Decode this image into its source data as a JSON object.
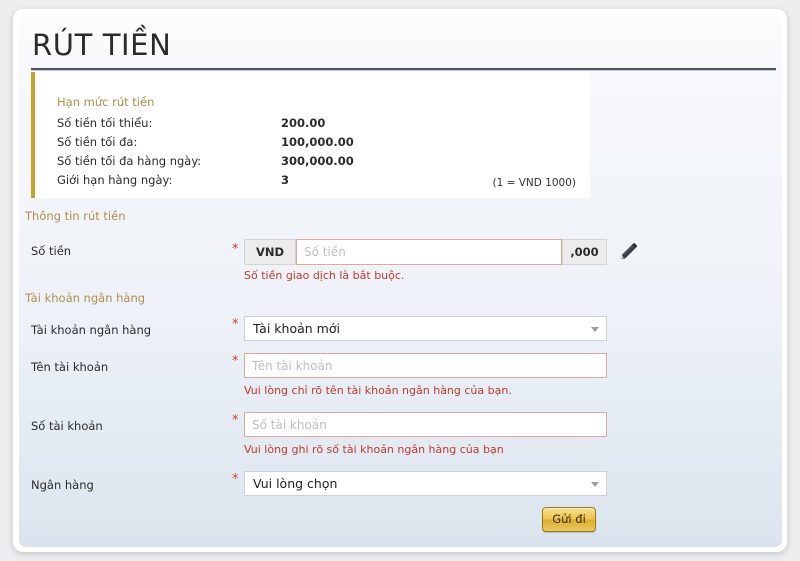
{
  "page": {
    "title": "RÚT TIỀN"
  },
  "limits": {
    "heading": "Hạn mức rút tiền",
    "rows": [
      {
        "label": "Số tiền tối thiểu:",
        "value": "200.00"
      },
      {
        "label": "Số tiền tối đa:",
        "value": "100,000.00"
      },
      {
        "label": "Số tiền tối đa hàng ngày:",
        "value": "300,000.00"
      },
      {
        "label": "Giới hạn hàng ngày:",
        "value": "3"
      }
    ],
    "note": "(1 = VND 1000)"
  },
  "withdraw_info": {
    "section_heading": "Thông tin rút tiền",
    "amount": {
      "label": "Số tiền",
      "required_marker": "*",
      "currency_prefix": "VND",
      "placeholder": "Số tiền",
      "value": "",
      "suffix": ",000",
      "edit_icon": "pencil-icon",
      "error": "Số tiền giao dịch là bắt buộc."
    }
  },
  "bank_account": {
    "section_heading": "Tài khoản ngân hàng",
    "account_select": {
      "label": "Tài khoản ngân hàng",
      "required_marker": "*",
      "selected": "Tài khoản mới"
    },
    "account_name": {
      "label": "Tên tài khoản",
      "required_marker": "*",
      "placeholder": "Tên tài khoản",
      "value": "",
      "error": "Vui lòng chỉ rõ tên tài khoản ngân hàng của bạn."
    },
    "account_number": {
      "label": "Số tài khoản",
      "required_marker": "*",
      "placeholder": "Số tài khoản",
      "value": "",
      "error": "Vui lòng ghi rõ số tài khoản ngân hàng của bạn"
    },
    "bank_select": {
      "label": "Ngân hàng",
      "required_marker": "*",
      "selected": "Vui lòng chọn"
    }
  },
  "actions": {
    "submit_label": "Gửi đi"
  },
  "colors": {
    "accent_gold": "#b08d4a",
    "error_red": "#bf3b2c",
    "rule_dark": "#4a5464",
    "button_gold": "#e5c04a"
  }
}
